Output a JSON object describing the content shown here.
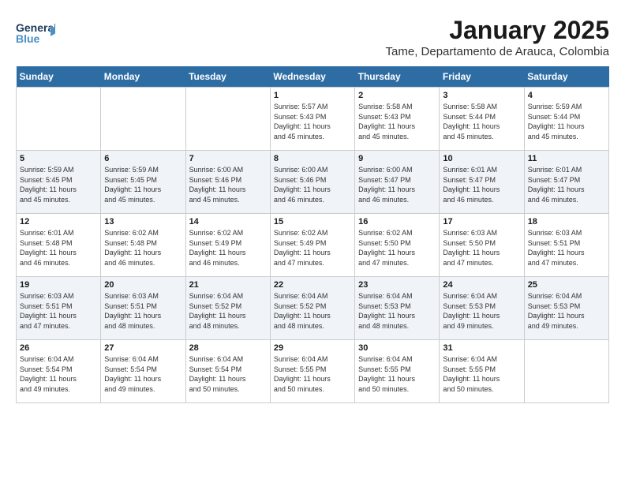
{
  "header": {
    "logo_line1": "General",
    "logo_line2": "Blue",
    "month_year": "January 2025",
    "location": "Tame, Departamento de Arauca, Colombia"
  },
  "days_of_week": [
    "Sunday",
    "Monday",
    "Tuesday",
    "Wednesday",
    "Thursday",
    "Friday",
    "Saturday"
  ],
  "weeks": [
    [
      {
        "day": "",
        "info": ""
      },
      {
        "day": "",
        "info": ""
      },
      {
        "day": "",
        "info": ""
      },
      {
        "day": "1",
        "info": "Sunrise: 5:57 AM\nSunset: 5:43 PM\nDaylight: 11 hours\nand 45 minutes."
      },
      {
        "day": "2",
        "info": "Sunrise: 5:58 AM\nSunset: 5:43 PM\nDaylight: 11 hours\nand 45 minutes."
      },
      {
        "day": "3",
        "info": "Sunrise: 5:58 AM\nSunset: 5:44 PM\nDaylight: 11 hours\nand 45 minutes."
      },
      {
        "day": "4",
        "info": "Sunrise: 5:59 AM\nSunset: 5:44 PM\nDaylight: 11 hours\nand 45 minutes."
      }
    ],
    [
      {
        "day": "5",
        "info": "Sunrise: 5:59 AM\nSunset: 5:45 PM\nDaylight: 11 hours\nand 45 minutes."
      },
      {
        "day": "6",
        "info": "Sunrise: 5:59 AM\nSunset: 5:45 PM\nDaylight: 11 hours\nand 45 minutes."
      },
      {
        "day": "7",
        "info": "Sunrise: 6:00 AM\nSunset: 5:46 PM\nDaylight: 11 hours\nand 45 minutes."
      },
      {
        "day": "8",
        "info": "Sunrise: 6:00 AM\nSunset: 5:46 PM\nDaylight: 11 hours\nand 46 minutes."
      },
      {
        "day": "9",
        "info": "Sunrise: 6:00 AM\nSunset: 5:47 PM\nDaylight: 11 hours\nand 46 minutes."
      },
      {
        "day": "10",
        "info": "Sunrise: 6:01 AM\nSunset: 5:47 PM\nDaylight: 11 hours\nand 46 minutes."
      },
      {
        "day": "11",
        "info": "Sunrise: 6:01 AM\nSunset: 5:47 PM\nDaylight: 11 hours\nand 46 minutes."
      }
    ],
    [
      {
        "day": "12",
        "info": "Sunrise: 6:01 AM\nSunset: 5:48 PM\nDaylight: 11 hours\nand 46 minutes."
      },
      {
        "day": "13",
        "info": "Sunrise: 6:02 AM\nSunset: 5:48 PM\nDaylight: 11 hours\nand 46 minutes."
      },
      {
        "day": "14",
        "info": "Sunrise: 6:02 AM\nSunset: 5:49 PM\nDaylight: 11 hours\nand 46 minutes."
      },
      {
        "day": "15",
        "info": "Sunrise: 6:02 AM\nSunset: 5:49 PM\nDaylight: 11 hours\nand 47 minutes."
      },
      {
        "day": "16",
        "info": "Sunrise: 6:02 AM\nSunset: 5:50 PM\nDaylight: 11 hours\nand 47 minutes."
      },
      {
        "day": "17",
        "info": "Sunrise: 6:03 AM\nSunset: 5:50 PM\nDaylight: 11 hours\nand 47 minutes."
      },
      {
        "day": "18",
        "info": "Sunrise: 6:03 AM\nSunset: 5:51 PM\nDaylight: 11 hours\nand 47 minutes."
      }
    ],
    [
      {
        "day": "19",
        "info": "Sunrise: 6:03 AM\nSunset: 5:51 PM\nDaylight: 11 hours\nand 47 minutes."
      },
      {
        "day": "20",
        "info": "Sunrise: 6:03 AM\nSunset: 5:51 PM\nDaylight: 11 hours\nand 48 minutes."
      },
      {
        "day": "21",
        "info": "Sunrise: 6:04 AM\nSunset: 5:52 PM\nDaylight: 11 hours\nand 48 minutes."
      },
      {
        "day": "22",
        "info": "Sunrise: 6:04 AM\nSunset: 5:52 PM\nDaylight: 11 hours\nand 48 minutes."
      },
      {
        "day": "23",
        "info": "Sunrise: 6:04 AM\nSunset: 5:53 PM\nDaylight: 11 hours\nand 48 minutes."
      },
      {
        "day": "24",
        "info": "Sunrise: 6:04 AM\nSunset: 5:53 PM\nDaylight: 11 hours\nand 49 minutes."
      },
      {
        "day": "25",
        "info": "Sunrise: 6:04 AM\nSunset: 5:53 PM\nDaylight: 11 hours\nand 49 minutes."
      }
    ],
    [
      {
        "day": "26",
        "info": "Sunrise: 6:04 AM\nSunset: 5:54 PM\nDaylight: 11 hours\nand 49 minutes."
      },
      {
        "day": "27",
        "info": "Sunrise: 6:04 AM\nSunset: 5:54 PM\nDaylight: 11 hours\nand 49 minutes."
      },
      {
        "day": "28",
        "info": "Sunrise: 6:04 AM\nSunset: 5:54 PM\nDaylight: 11 hours\nand 50 minutes."
      },
      {
        "day": "29",
        "info": "Sunrise: 6:04 AM\nSunset: 5:55 PM\nDaylight: 11 hours\nand 50 minutes."
      },
      {
        "day": "30",
        "info": "Sunrise: 6:04 AM\nSunset: 5:55 PM\nDaylight: 11 hours\nand 50 minutes."
      },
      {
        "day": "31",
        "info": "Sunrise: 6:04 AM\nSunset: 5:55 PM\nDaylight: 11 hours\nand 50 minutes."
      },
      {
        "day": "",
        "info": ""
      }
    ]
  ]
}
